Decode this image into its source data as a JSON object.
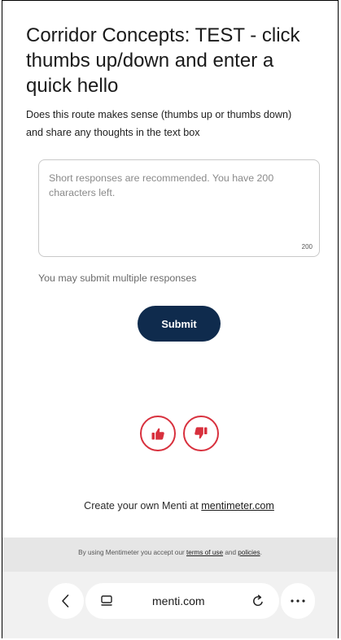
{
  "survey": {
    "title": "Corridor Concepts: TEST - click thumbs up/down and enter a quick hello",
    "question": "Does this route makes sense (thumbs up or thumbs down) and share any thoughts in the text box",
    "response_placeholder": "Short responses are recommended. You have 200 characters left.",
    "char_count": "200",
    "multiple_note": "You may submit multiple responses",
    "submit_label": "Submit"
  },
  "votes": {
    "up_icon": "thumbs-up-icon",
    "down_icon": "thumbs-down-icon"
  },
  "footer": {
    "create_text": "Create your own Menti at ",
    "create_link": "mentimeter.com",
    "terms_prefix": "By using Mentimeter you accept our ",
    "terms_link": "terms of use",
    "terms_and": " and ",
    "policies_link": "policies",
    "terms_suffix": "."
  },
  "browser": {
    "url": "menti.com",
    "icons": [
      "chevron-left-icon",
      "tabs-icon",
      "reload-icon",
      "more-icon"
    ]
  },
  "colors": {
    "primary": "#0f2b4d",
    "vote_accent": "#d8303d",
    "terms_bg": "#e6e6e6",
    "browser_bg": "#f1f1f1"
  }
}
